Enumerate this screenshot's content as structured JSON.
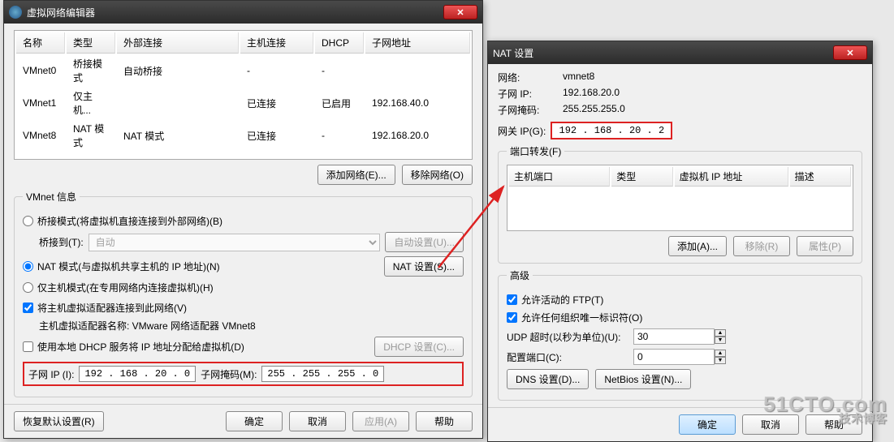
{
  "vnet_editor": {
    "title": "虚拟网络编辑器",
    "close": "✕",
    "table": {
      "headers": {
        "name": "名称",
        "type": "类型",
        "ext": "外部连接",
        "host": "主机连接",
        "dhcp": "DHCP",
        "subnet": "子网地址"
      },
      "rows": [
        {
          "name": "VMnet0",
          "type": "桥接模式",
          "ext": "自动桥接",
          "host": "-",
          "dhcp": "-",
          "subnet": ""
        },
        {
          "name": "VMnet1",
          "type": "仅主机...",
          "ext": "",
          "host": "已连接",
          "dhcp": "已启用",
          "subnet": "192.168.40.0"
        },
        {
          "name": "VMnet8",
          "type": "NAT 模式",
          "ext": "NAT 模式",
          "host": "已连接",
          "dhcp": "-",
          "subnet": "192.168.20.0"
        }
      ]
    },
    "add_net_btn": "添加网络(E)...",
    "remove_net_btn": "移除网络(O)",
    "vmnet_info_legend": "VMnet 信息",
    "bridge_radio": "桥接模式(将虚拟机直接连接到外部网络)(B)",
    "bridge_to_label": "桥接到(T):",
    "bridge_to_value": "自动",
    "auto_settings_btn": "自动设置(U)...",
    "nat_radio": "NAT 模式(与虚拟机共享主机的 IP 地址)(N)",
    "nat_settings_btn": "NAT 设置(S)...",
    "hostonly_radio": "仅主机模式(在专用网络内连接虚拟机)(H)",
    "connect_host_check": "将主机虚拟适配器连接到此网络(V)",
    "host_adapter_label": "主机虚拟适配器名称: VMware 网络适配器 VMnet8",
    "use_dhcp_check": "使用本地 DHCP 服务将 IP 地址分配给虚拟机(D)",
    "dhcp_settings_btn": "DHCP 设置(C)...",
    "subnet_ip_label": "子网 IP (I):",
    "subnet_ip_value": "192 . 168 . 20 . 0",
    "subnet_mask_label": "子网掩码(M):",
    "subnet_mask_value": "255 . 255 . 255 . 0",
    "restore_btn": "恢复默认设置(R)",
    "ok_btn": "确定",
    "cancel_btn": "取消",
    "apply_btn": "应用(A)",
    "help_btn": "帮助"
  },
  "nat_settings": {
    "title": "NAT 设置",
    "close": "✕",
    "network_label": "网络:",
    "network_value": "vmnet8",
    "subnetip_label": "子网 IP:",
    "subnetip_value": "192.168.20.0",
    "mask_label": "子网掩码:",
    "mask_value": "255.255.255.0",
    "gateway_label": "网关 IP(G):",
    "gateway_value": "192 . 168 . 20 . 2",
    "port_forward_legend": "端口转发(F)",
    "pf_headers": {
      "hostport": "主机端口",
      "type": "类型",
      "vmip": "虚拟机 IP 地址",
      "desc": "描述"
    },
    "add_btn": "添加(A)...",
    "remove_btn": "移除(R)",
    "props_btn": "属性(P)",
    "advanced_legend": "高级",
    "allow_ftp": "允许活动的 FTP(T)",
    "allow_oui": "允许任何组织唯一标识符(O)",
    "udp_timeout_label": "UDP 超时(以秒为单位)(U):",
    "udp_timeout_value": "30",
    "config_port_label": "配置端口(C):",
    "config_port_value": "0",
    "dns_btn": "DNS 设置(D)...",
    "netbios_btn": "NetBios 设置(N)...",
    "ok_btn": "确定",
    "cancel_btn": "取消",
    "help_btn": "帮助"
  },
  "watermark": {
    "line1": "51CTO.com",
    "line2": "技术博客"
  }
}
